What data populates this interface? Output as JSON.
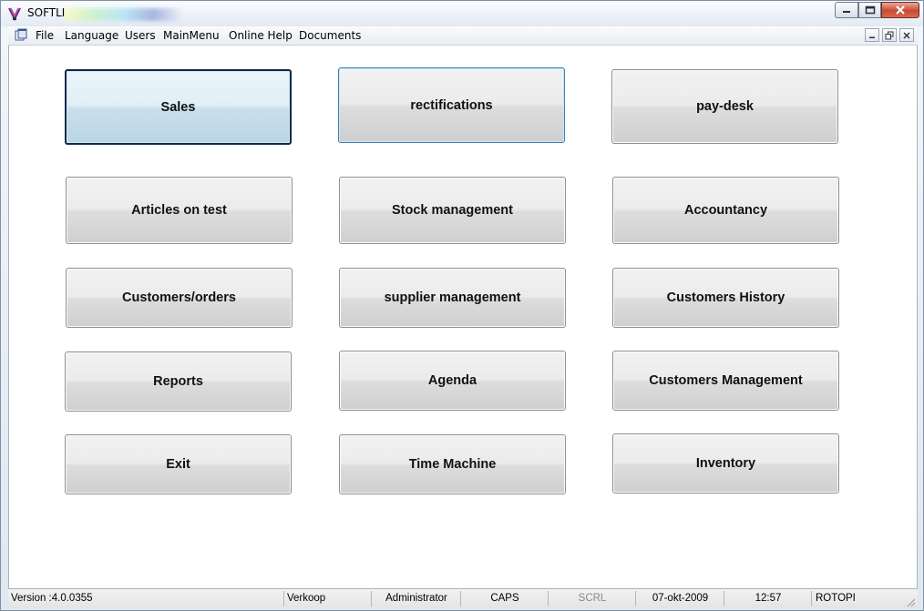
{
  "window": {
    "title": "SOFTLI"
  },
  "menubar": {
    "items": [
      "File",
      "Language",
      "Users",
      "MainMenu",
      "Online Help",
      "Documents"
    ]
  },
  "buttons": {
    "sales": "Sales",
    "rectifications": "rectifications",
    "pay_desk": "pay-desk",
    "articles_on_test": "Articles on test",
    "stock_management": "Stock management",
    "accountancy": "Accountancy",
    "customers_orders": "Customers/orders",
    "supplier_management": "supplier management",
    "customers_history": "Customers History",
    "reports": "Reports",
    "agenda": "Agenda",
    "customers_management": "Customers Management",
    "exit": "Exit",
    "time_machine": "Time Machine",
    "inventory": "Inventory"
  },
  "statusbar": {
    "version": "Version :4.0.0355",
    "module": "Verkoop",
    "user": "Administrator",
    "caps": "CAPS",
    "scrl": "SCRL",
    "date": "07-okt-2009",
    "time": "12:57",
    "machine": "ROTOPI"
  },
  "colors": {
    "title_close": "#c84a31",
    "default_button_border": "#0c2a4a",
    "focus_button_border": "#3c7fb1"
  },
  "icons": {
    "app": "softli-logo-icon",
    "menu_doc": "mdi-document-icon",
    "minimize": "minimize-icon",
    "maximize": "maximize-icon",
    "close": "close-icon",
    "restore": "restore-icon",
    "grip": "resize-grip-icon"
  }
}
